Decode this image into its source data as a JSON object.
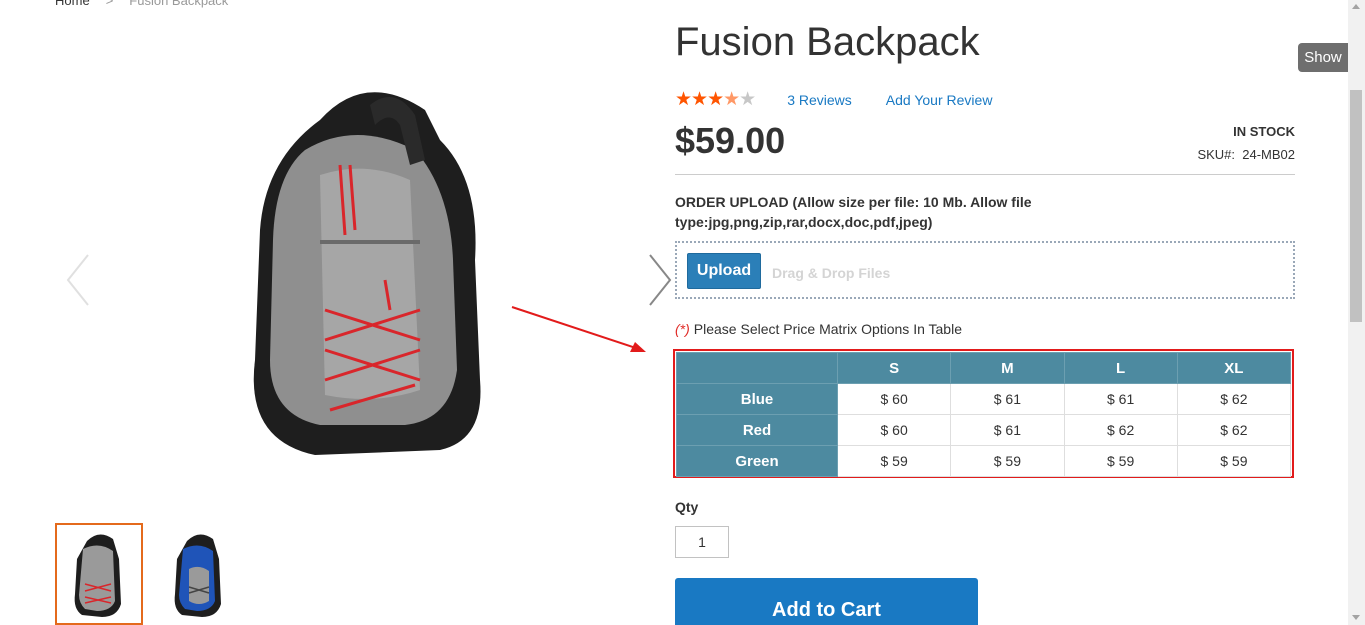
{
  "breadcrumb": {
    "home": "Home",
    "separator": ">",
    "current": "Fusion Backpack"
  },
  "product": {
    "title": "Fusion Backpack",
    "rating_stars": 3.5,
    "reviews_link": "3 Reviews",
    "add_review_link": "Add Your Review",
    "price": "$59.00",
    "stock": "IN STOCK",
    "sku_label": "SKU#:",
    "sku_value": "24-MB02"
  },
  "upload": {
    "label": "ORDER UPLOAD (Allow size per file: 10 Mb. Allow file type:jpg,png,zip,rar,docx,doc,pdf,jpeg)",
    "button": "Upload",
    "drop_text": "Drag & Drop Files"
  },
  "matrix": {
    "required_marker": "(*)",
    "note": "Please Select Price Matrix Options In Table",
    "columns": [
      "S",
      "M",
      "L",
      "XL"
    ],
    "rows": [
      {
        "label": "Blue",
        "values": [
          "$ 60",
          "$ 61",
          "$ 61",
          "$ 62"
        ]
      },
      {
        "label": "Red",
        "values": [
          "$ 60",
          "$ 61",
          "$ 62",
          "$ 62"
        ]
      },
      {
        "label": "Green",
        "values": [
          "$ 59",
          "$ 59",
          "$ 59",
          "$ 59"
        ]
      }
    ]
  },
  "qty": {
    "label": "Qty",
    "value": "1"
  },
  "cart_button": "Add to Cart",
  "side_tab": "Show",
  "colors": {
    "accent": "#1979c3",
    "matrix_header": "#4d8aa0",
    "highlight": "#e21b1b",
    "star": "#ff5501",
    "thumb_active": "#e46a1c"
  }
}
